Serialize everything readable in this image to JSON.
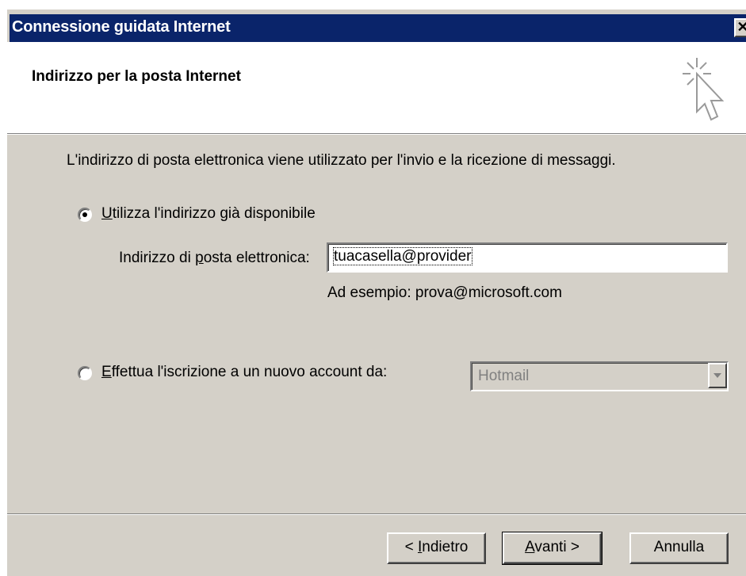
{
  "window": {
    "title": "Connessione guidata Internet",
    "close_glyph": "✕"
  },
  "header": {
    "title": "Indirizzo per la posta Internet",
    "icon": "wizard-cursor-icon"
  },
  "content": {
    "intro": "L'indirizzo di posta elettronica viene utilizzato per l'invio e la ricezione di messaggi.",
    "option_existing": {
      "label_first": "U",
      "label_rest": "tilizza l'indirizzo già disponibile",
      "selected": true
    },
    "email_field": {
      "label_prefix": "Indirizzo di ",
      "label_accel": "p",
      "label_rest": "osta elettronica:",
      "value": "tuacasella@provider"
    },
    "example": "Ad esempio: prova@microsoft.com",
    "option_new": {
      "label_first": "E",
      "label_rest": "ffettua l'iscrizione a un nuovo account da:",
      "selected": false
    },
    "provider_select": {
      "value": "Hotmail",
      "enabled": false
    }
  },
  "buttons": {
    "back_prefix": "< ",
    "back_accel": "I",
    "back_rest": "ndietro",
    "next_accel": "A",
    "next_rest": "vanti >",
    "cancel": "Annulla"
  },
  "colors": {
    "titlebar": "#0a246a",
    "face": "#d4d0c8"
  }
}
